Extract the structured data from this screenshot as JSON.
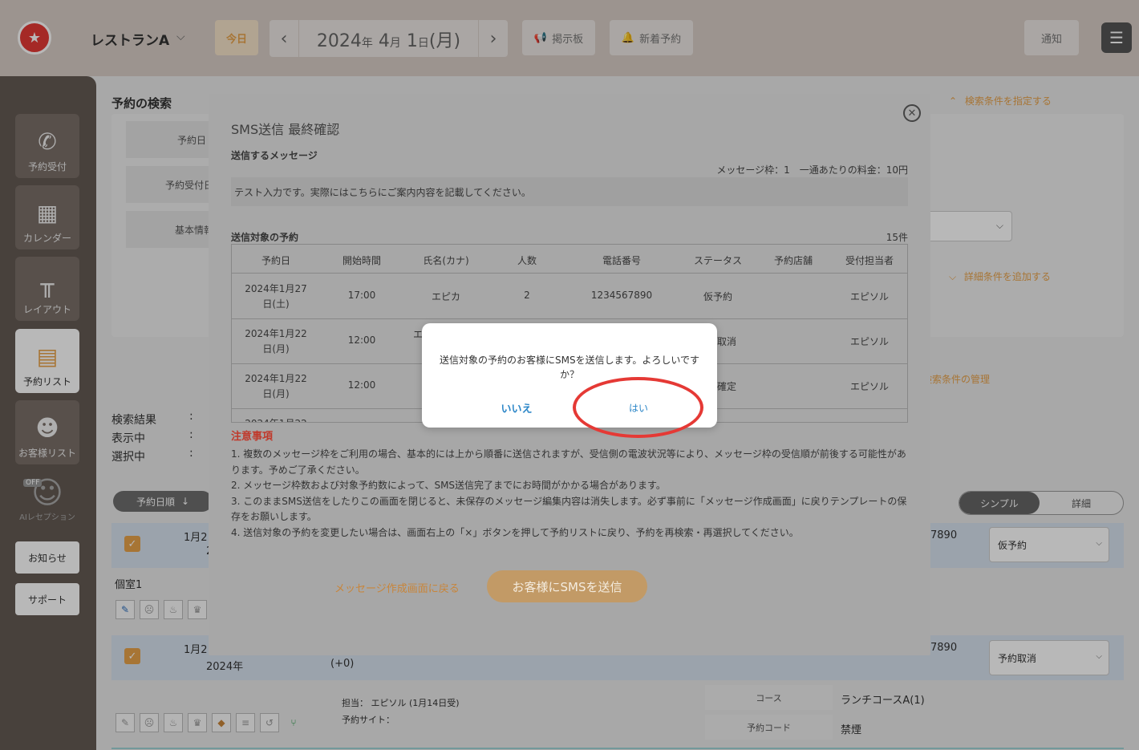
{
  "header": {
    "logo_text": "★",
    "store_name": "レストランA",
    "today": "今日",
    "date_year": "2024",
    "date_year_unit": "年",
    "date_month": "4",
    "date_month_unit": "月",
    "date_day": "1",
    "date_day_unit": "日",
    "date_weekday": "(月)",
    "board": "掲示板",
    "new_reservation": "新着予約",
    "notify": "通知"
  },
  "sidebar": {
    "items": [
      {
        "label": "予約受付"
      },
      {
        "label": "カレンダー"
      },
      {
        "label": "レイアウト"
      },
      {
        "label": "予約リスト"
      },
      {
        "label": "お客様リスト"
      }
    ],
    "ai_label": "AIレセプション",
    "ai_badge": "OFF",
    "news": "お知らせ",
    "support": "サポート"
  },
  "search": {
    "title": "予約の検索",
    "labels": [
      "予約日",
      "予約受付日",
      "基本情報"
    ],
    "specify_link": "検索条件を指定する",
    "add_link": "詳細条件を追加する",
    "manage_link": "検索条件の管理"
  },
  "results": {
    "labels": [
      "検索結果",
      "表示中",
      "選択中"
    ],
    "colon": ":",
    "sort": "予約日順",
    "view_simple": "シンプル",
    "view_detail": "詳細"
  },
  "list": {
    "row1": {
      "date": "1月2",
      "date2": "2",
      "room": "個室1",
      "phone": "7890",
      "status": "仮予約"
    },
    "row2": {
      "date": "1月2",
      "year": "2024年",
      "delta": "(+0)",
      "phone": "7890",
      "status": "予約取消",
      "staff_label": "担当：",
      "staff": "エピソル (1月14日受)",
      "site_label": "予約サイト：",
      "course_label": "コース",
      "course": "ランチコースA(1)",
      "code_label": "予約コード",
      "code": "禁煙"
    }
  },
  "modal": {
    "title": "SMS送信 最終確認",
    "message_label": "送信するメッセージ",
    "message_meta": "メッセージ枠：1　一通あたりの料金：10円",
    "message_text": "テスト入力です。実際にはこちらにご案内内容を記載してください。",
    "targets_label": "送信対象の予約",
    "targets_count": "15件",
    "columns": [
      "予約日",
      "開始時間",
      "氏名(カナ)",
      "人数",
      "電話番号",
      "ステータス",
      "予約店舗",
      "受付担当者"
    ],
    "rows": [
      {
        "date1": "2024年1月27",
        "date2": "日(土)",
        "time": "17:00",
        "name": "エピカ",
        "people": "2",
        "phone": "1234567890",
        "status": "仮予約",
        "store": "",
        "staff": "エピソル"
      },
      {
        "date1": "2024年1月22",
        "date2": "日(月)",
        "time": "12:00",
        "name": "エ",
        "people": "",
        "phone": "",
        "status": "取消",
        "store": "",
        "staff": "エピソル"
      },
      {
        "date1": "2024年1月22",
        "date2": "日(月)",
        "time": "12:00",
        "name": "",
        "people": "",
        "phone": "",
        "status": "確定",
        "store": "",
        "staff": "エピソル"
      },
      {
        "date1": "2024年1月22",
        "date2": "",
        "time": "",
        "name": "",
        "people": "",
        "phone": "",
        "status": "",
        "store": "",
        "staff": ""
      }
    ],
    "notes_title": "注意事項",
    "notes": [
      "1. 複数のメッセージ枠をご利用の場合、基本的には上から順番に送信されますが、受信側の電波状況等により、メッセージ枠の受信順が前後する可能性があります。予めご了承ください。",
      "2. メッセージ枠数および対象予約数によって、SMS送信完了までにお時間がかかる場合があります。",
      "3. このままSMS送信をしたりこの画面を閉じると、未保存のメッセージ編集内容は消失します。必ず事前に「メッセージ作成画面」に戻りテンプレートの保存をお願いします。",
      "4. 送信対象の予約を変更したい場合は、画面右上の「×」ボタンを押して予約リストに戻り、予約を再検索・再選択してください。"
    ],
    "back": "メッセージ作成画面に戻る",
    "send": "お客様にSMSを送信"
  },
  "confirm": {
    "message": "送信対象の予約のお客様にSMSを送信します。よろしいですか？",
    "no": "いいえ",
    "yes": "はい"
  },
  "colors": {
    "accent": "#e8a24a",
    "link_blue": "#2d87c8",
    "highlight_red": "#e53935"
  }
}
